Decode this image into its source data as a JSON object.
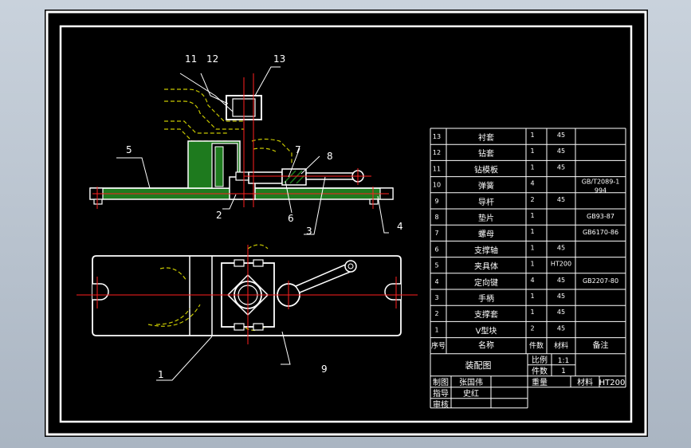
{
  "window": {
    "bg": "#b8c3cf",
    "canvas_bg": "#000000"
  },
  "colors": {
    "line": "#ffffff",
    "center": "#ff2020",
    "phantom": "#c8c800",
    "hatch": "#1e7a1e",
    "leader": "#ffffff"
  },
  "callouts": {
    "c1": "1",
    "c2": "2",
    "c3": "3",
    "c4": "4",
    "c5": "5",
    "c6": "6",
    "c7": "7",
    "c8": "8",
    "c9": "9",
    "c11": "11",
    "c12": "12",
    "c13": "13"
  },
  "bom": {
    "rows": [
      {
        "no": "13",
        "name": "衬套",
        "qty": "1",
        "mat": "45",
        "std": ""
      },
      {
        "no": "12",
        "name": "钻套",
        "qty": "1",
        "mat": "45",
        "std": ""
      },
      {
        "no": "11",
        "name": "钻模板",
        "qty": "1",
        "mat": "45",
        "std": ""
      },
      {
        "no": "10",
        "name": "弹簧",
        "qty": "4",
        "mat": "",
        "std": "GB/T2089-1\n994"
      },
      {
        "no": "9",
        "name": "导杆",
        "qty": "2",
        "mat": "45",
        "std": ""
      },
      {
        "no": "8",
        "name": "垫片",
        "qty": "1",
        "mat": "",
        "std": "GB93-87"
      },
      {
        "no": "7",
        "name": "螺母",
        "qty": "1",
        "mat": "",
        "std": "GB6170-86"
      },
      {
        "no": "6",
        "name": "支撑轴",
        "qty": "1",
        "mat": "45",
        "std": ""
      },
      {
        "no": "5",
        "name": "夹具体",
        "qty": "1",
        "mat": "HT200",
        "std": ""
      },
      {
        "no": "4",
        "name": "定向键",
        "qty": "4",
        "mat": "45",
        "std": "GB2207-80"
      },
      {
        "no": "3",
        "name": "手柄",
        "qty": "1",
        "mat": "45",
        "std": ""
      },
      {
        "no": "2",
        "name": "支撑套",
        "qty": "1",
        "mat": "45",
        "std": ""
      },
      {
        "no": "1",
        "name": "V型块",
        "qty": "2",
        "mat": "45",
        "std": ""
      }
    ],
    "header": {
      "no": "序号",
      "name": "名称",
      "qty": "件数",
      "mat": "材料",
      "std": "备注"
    }
  },
  "titleblock": {
    "title": "装配图",
    "scale_label": "比例",
    "scale_value": "1:1",
    "count_label": "件数",
    "count_value": "1",
    "weight_label": "重量",
    "material_label": "材料",
    "material_value": "HT200",
    "drawn_label": "制图",
    "drawn_name": "张国伟",
    "guide_label": "指导",
    "guide_name": "史红",
    "check_label": "审核"
  }
}
